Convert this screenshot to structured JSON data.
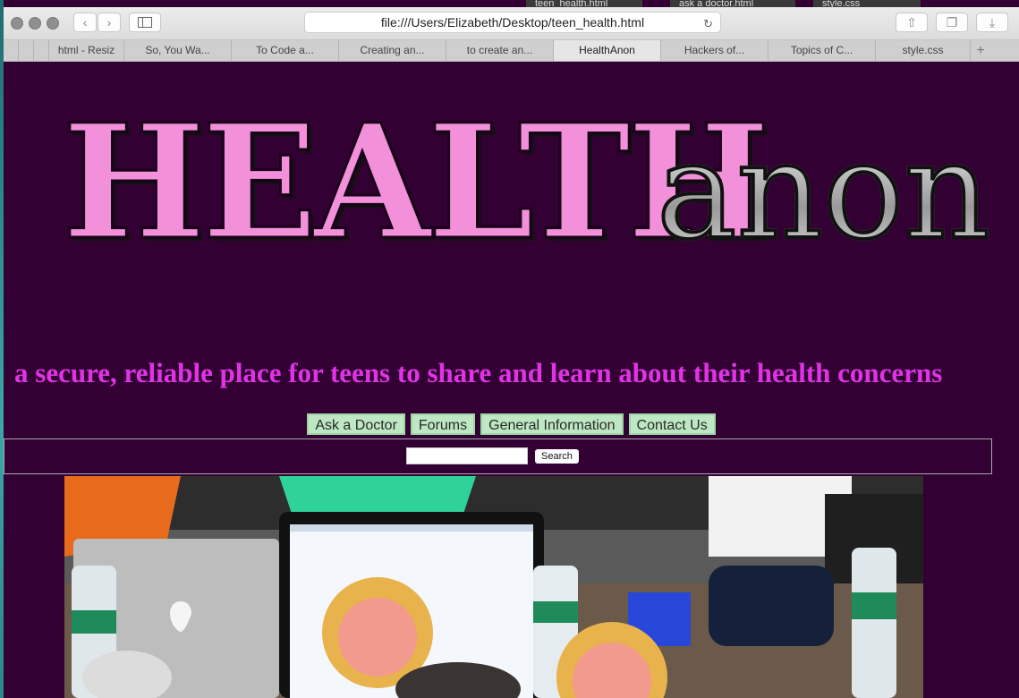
{
  "browser": {
    "peek_tabs": [
      "teen_health.html",
      "ask a doctor.html",
      "style.css"
    ],
    "address": "file:///Users/Elizabeth/Desktop/teen_health.html",
    "tabs": [
      {
        "label": "html - Resiz"
      },
      {
        "label": "So, You Wa..."
      },
      {
        "label": "To Code a..."
      },
      {
        "label": "Creating an..."
      },
      {
        "label": "to create an..."
      },
      {
        "label": "HealthAnon",
        "active": true
      },
      {
        "label": "Hackers of..."
      },
      {
        "label": "Topics of C..."
      },
      {
        "label": "style.css"
      }
    ],
    "new_tab_label": "+"
  },
  "site": {
    "logo_health": "HEALTH",
    "logo_anon": "anon",
    "tagline": "a secure, reliable place for teens to share and learn about their health concerns",
    "nav": [
      "Ask a Doctor",
      "Forums",
      "General Information",
      "Contact Us"
    ],
    "search_button": "Search"
  },
  "colors": {
    "page_background": "#330033",
    "logo_pink": "#f290d9",
    "tagline_magenta": "#e033e6",
    "nav_button_bg": "#bde8c3"
  }
}
